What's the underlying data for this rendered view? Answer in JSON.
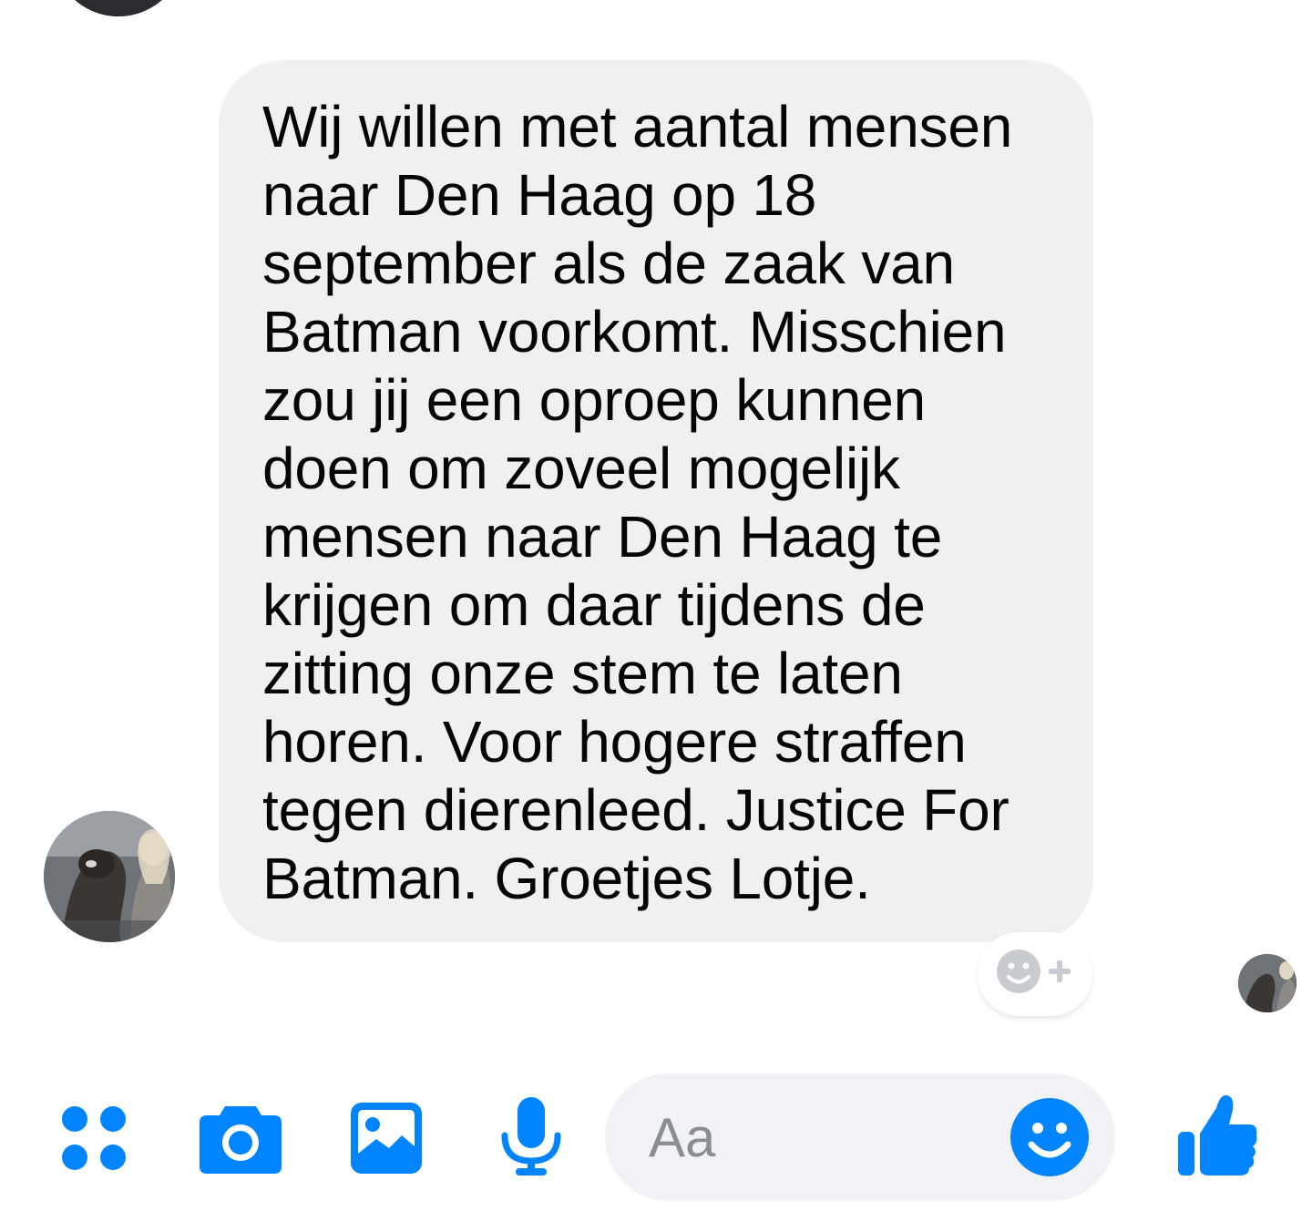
{
  "conversation": {
    "message": {
      "text": "Wij willen met aantal mensen\nnaar Den Haag op 18\nseptember als de zaak van\nBatman voorkomt. Misschien\nzou jij een oproep kunnen\ndoen om zoveel mogelijk\nmensen naar Den Haag te\nkrijgen om daar tijdens de\nzitting onze stem te laten\nhoren. Voor hogere straffen\ntegen dierenleed. Justice For\nBatman.  Groetjes Lotje.",
      "bubble_color": "#f0f0f0"
    },
    "reaction_button": {
      "icon": "add-reaction-icon"
    },
    "seen_indicator": {
      "icon": "seen-avatar"
    }
  },
  "composer": {
    "accent_color": "#0084ff",
    "more_icon": "four-dots-icon",
    "camera_icon": "camera-icon",
    "gallery_icon": "gallery-icon",
    "mic_icon": "microphone-icon",
    "input": {
      "placeholder": "Aa",
      "value": ""
    },
    "emoji_icon": "smiley-icon",
    "like_icon": "thumbs-up-icon"
  }
}
